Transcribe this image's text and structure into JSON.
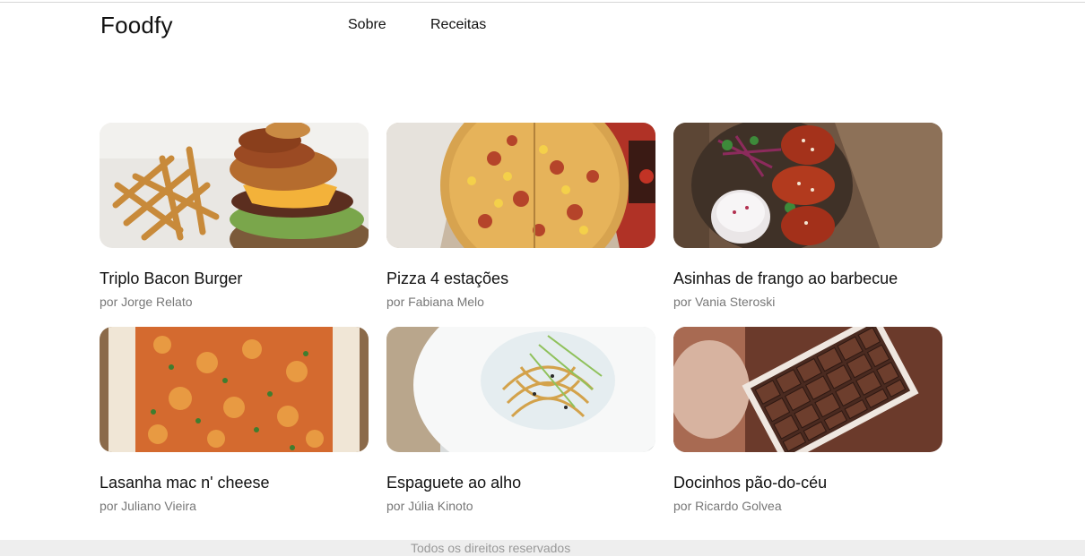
{
  "brand": {
    "name": "Foodfy"
  },
  "nav": {
    "items": [
      "Sobre",
      "Receitas"
    ]
  },
  "recipes": [
    {
      "title": "Triplo Bacon Burger",
      "author": "por Jorge Relato",
      "image": "burger-photo"
    },
    {
      "title": "Pizza 4 estações",
      "author": "por Fabiana Melo",
      "image": "pizza-photo"
    },
    {
      "title": "Asinhas de frango ao barbecue",
      "author": "por Vania Steroski",
      "image": "chicken-wings-photo"
    },
    {
      "title": "Lasanha mac n' cheese",
      "author": "por Juliano Vieira",
      "image": "lasagna-photo"
    },
    {
      "title": "Espaguete ao alho",
      "author": "por Júlia Kinoto",
      "image": "spaghetti-photo"
    },
    {
      "title": "Docinhos pão-do-céu",
      "author": "por Ricardo Golvea",
      "image": "chocolates-photo"
    }
  ],
  "footer": {
    "text": "Todos os direitos reservados"
  }
}
